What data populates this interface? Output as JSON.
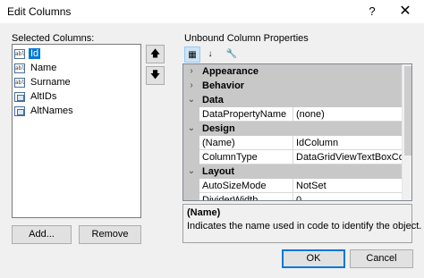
{
  "window": {
    "title": "Edit Columns",
    "help_glyph": "?",
    "close_glyph": "✕"
  },
  "left": {
    "label": "Selected Columns:",
    "columns": [
      {
        "label": "Id",
        "icon": "textbox-column-icon",
        "icon_text": "abl",
        "selected": true
      },
      {
        "label": "Name",
        "icon": "textbox-column-icon",
        "icon_text": "abl",
        "selected": false
      },
      {
        "label": "Surname",
        "icon": "textbox-column-icon",
        "icon_text": "abl",
        "selected": false
      },
      {
        "label": "AltIDs",
        "icon": "combobox-column-icon",
        "icon_text": "",
        "selected": false
      },
      {
        "label": "AltNames",
        "icon": "combobox-column-icon",
        "icon_text": "",
        "selected": false
      }
    ],
    "move_up_glyph": "🡅",
    "move_down_glyph": "🡇",
    "add_label": "Add...",
    "remove_label": "Remove"
  },
  "right": {
    "label": "Unbound Column Properties",
    "toolbar": {
      "categorized_glyph": "▦",
      "alphabetical_glyph": "↓",
      "property_pages_glyph": "🔧"
    },
    "grid": [
      {
        "type": "category",
        "name": "Appearance",
        "expanded": false
      },
      {
        "type": "category",
        "name": "Behavior",
        "expanded": false
      },
      {
        "type": "category",
        "name": "Data",
        "expanded": true
      },
      {
        "type": "property",
        "name": "DataPropertyName",
        "value": "(none)"
      },
      {
        "type": "category",
        "name": "Design",
        "expanded": true
      },
      {
        "type": "property",
        "name": "(Name)",
        "value": "IdColumn"
      },
      {
        "type": "property",
        "name": "ColumnType",
        "value": "DataGridViewTextBoxColum"
      },
      {
        "type": "category",
        "name": "Layout",
        "expanded": true
      },
      {
        "type": "property",
        "name": "AutoSizeMode",
        "value": "NotSet"
      },
      {
        "type": "property",
        "name": "DividerWidth",
        "value": "0"
      }
    ],
    "description": {
      "title": "(Name)",
      "text": "Indicates the name used in code to identify the object."
    }
  },
  "footer": {
    "ok_label": "OK",
    "cancel_label": "Cancel"
  },
  "colors": {
    "selection": "#0078d7",
    "category_row": "#c8c8c8",
    "dialog_bg": "#f0f0f0"
  }
}
